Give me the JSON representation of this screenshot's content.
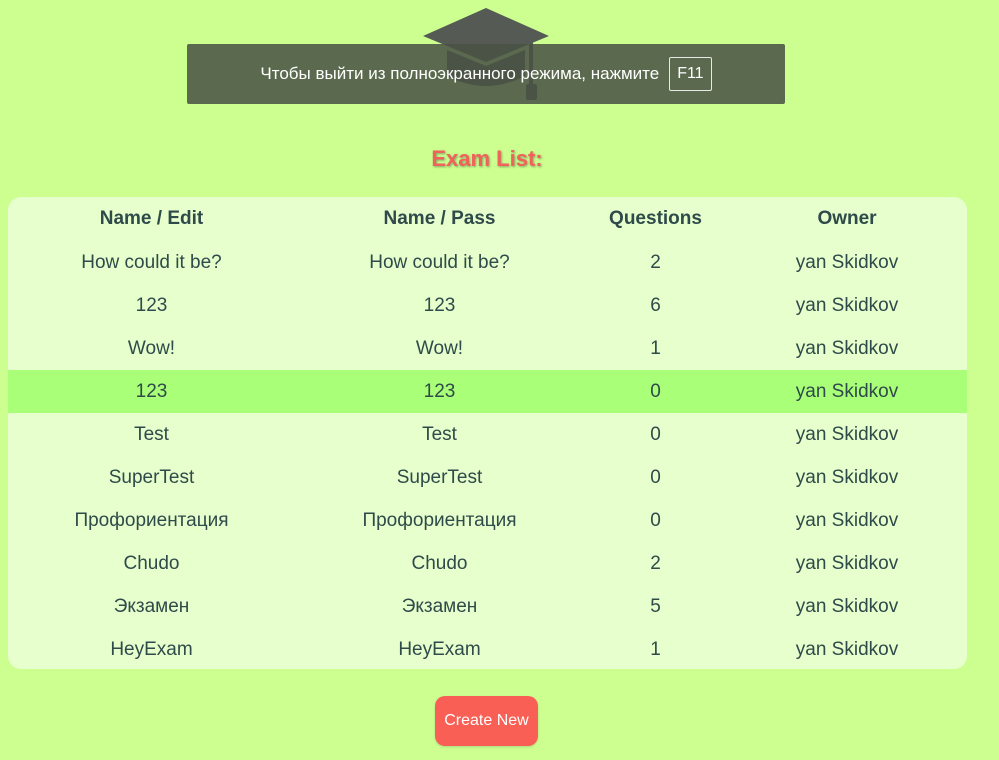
{
  "fullscreen_notice": {
    "text": "Чтобы выйти из полноэкранного режима, нажмите",
    "key": "F11"
  },
  "logo": {
    "icon": "graduation-cap-icon"
  },
  "title": "Exam List:",
  "table": {
    "headers": [
      "Name / Edit",
      "Name / Pass",
      "Questions",
      "Owner"
    ],
    "highlighted_row": 3,
    "rows": [
      [
        "How could it be?",
        "How could it be?",
        "2",
        "yan Skidkov"
      ],
      [
        "123",
        "123",
        "6",
        "yan Skidkov"
      ],
      [
        "Wow!",
        "Wow!",
        "1",
        "yan Skidkov"
      ],
      [
        "123",
        "123",
        "0",
        "yan Skidkov"
      ],
      [
        "Test",
        "Test",
        "0",
        "yan Skidkov"
      ],
      [
        "SuperTest",
        "SuperTest",
        "0",
        "yan Skidkov"
      ],
      [
        "Профориентация",
        "Профориентация",
        "0",
        "yan Skidkov"
      ],
      [
        "Chudo",
        "Chudo",
        "2",
        "yan Skidkov"
      ],
      [
        "Экзамен",
        "Экзамен",
        "5",
        "yan Skidkov"
      ],
      [
        "HeyExam",
        "HeyExam",
        "1",
        "yan Skidkov"
      ]
    ]
  },
  "create_button": "Create New",
  "colors": {
    "background": "#ccff90",
    "table_bg": "#e6ffcc",
    "highlight": "#aaff78",
    "accent": "#f95f54",
    "text": "#2f4a4a"
  }
}
